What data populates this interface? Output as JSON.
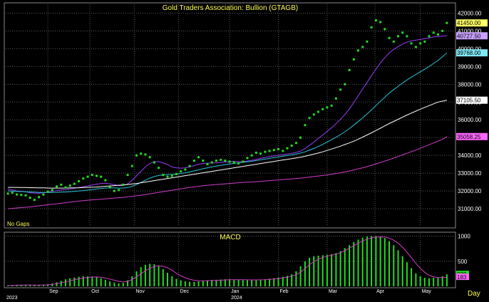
{
  "chart_data": [
    {
      "type": "scatter",
      "title": "Gold Traders Association: Bullion (GTAGB)",
      "note": "No Gaps",
      "colors": {
        "background": "#000000",
        "grid": "#5a5a5a",
        "price": "#22dd22",
        "ma1": "#9b3cff",
        "ma2": "#26c6da",
        "ma3": "#ffffff",
        "ma4": "#d23cc8",
        "title": "#ffff55",
        "axis_text": "#ffffff"
      },
      "ylim": [
        30000,
        42500
      ],
      "yticks": [
        "31000.00",
        "32000.00",
        "33000.00",
        "34000.00",
        "35000.00",
        "36000.00",
        "37000.00",
        "38000.00",
        "39000.00",
        "40000.00",
        "41000.00",
        "42000.00"
      ],
      "x_months": [
        "Sep",
        "Oct",
        "Nov",
        "Dec",
        "Jan",
        "Feb",
        "Mar",
        "Apr",
        "May"
      ],
      "x_years": [
        "2023",
        "2024"
      ],
      "x_unit": "Day",
      "grid": true,
      "series": [
        {
          "values": [
            31850,
            31900,
            31800,
            31780,
            31750,
            31620,
            31500,
            31650,
            31800,
            31950,
            32050,
            32250,
            32350,
            32200,
            32300,
            32400,
            32550,
            32700,
            32800,
            32900,
            32850,
            32800,
            32600,
            32200,
            32000,
            32050,
            32350,
            32900,
            33400,
            34000,
            34100,
            34050,
            33900,
            33600,
            33300,
            32900,
            32800,
            32850,
            32950,
            33100,
            33200,
            33400,
            33700,
            33900,
            33700,
            33500,
            33600,
            33700,
            33750,
            33700,
            33650,
            33600,
            33550,
            33650,
            33850,
            34000,
            34150,
            34100,
            34200,
            34250,
            34300,
            34350,
            34250,
            34400,
            34550,
            34700,
            35000,
            35700,
            36100,
            36300,
            36450,
            36600,
            36700,
            36800,
            37200,
            37700,
            38000,
            38800,
            39400,
            39900,
            40100,
            40400,
            41200,
            41600,
            41500,
            41100,
            40600,
            40400,
            40700,
            40900,
            40700,
            40300,
            40100,
            40300,
            40400,
            40700,
            40900,
            40800,
            41000,
            41450
          ]
        },
        {
          "values": [
            32100,
            32050,
            32000,
            31980,
            31950,
            31900,
            31880,
            31870,
            31900,
            31930,
            31970,
            32010,
            32050,
            32080,
            32110,
            32150,
            32190,
            32230,
            32280,
            32330,
            32380,
            32420,
            32430,
            32400,
            32350,
            32300,
            32300,
            32400,
            32600,
            32850,
            33100,
            33350,
            33550,
            33650,
            33650,
            33580,
            33480,
            33350,
            33300,
            33280,
            33300,
            33350,
            33420,
            33500,
            33550,
            33560,
            33570,
            33580,
            33600,
            33630,
            33650,
            33660,
            33650,
            33650,
            33680,
            33720,
            33780,
            33830,
            33880,
            33930,
            33970,
            34010,
            34040,
            34080,
            34120,
            34170,
            34240,
            34380,
            34560,
            34750,
            34950,
            35150,
            35350,
            35550,
            35780,
            36030,
            36300,
            36620,
            36970,
            37350,
            37730,
            38100,
            38480,
            38850,
            39200,
            39500,
            39760,
            39960,
            40120,
            40260,
            40370,
            40440,
            40480,
            40520,
            40560,
            40610,
            40660,
            40690,
            40710,
            40727
          ]
        },
        {
          "values": [
            32000,
            31990,
            31975,
            31965,
            31955,
            31945,
            31930,
            31915,
            31910,
            31910,
            31915,
            31920,
            31930,
            31945,
            31960,
            31980,
            32000,
            32020,
            32050,
            32080,
            32110,
            32140,
            32160,
            32170,
            32170,
            32160,
            32160,
            32190,
            32260,
            32360,
            32480,
            32600,
            32720,
            32810,
            32870,
            32900,
            32920,
            32930,
            32950,
            32980,
            33020,
            33070,
            33130,
            33190,
            33250,
            33300,
            33350,
            33400,
            33440,
            33480,
            33520,
            33550,
            33580,
            33610,
            33640,
            33670,
            33710,
            33750,
            33790,
            33830,
            33870,
            33910,
            33950,
            33990,
            34030,
            34080,
            34130,
            34200,
            34290,
            34390,
            34500,
            34620,
            34750,
            34880,
            35020,
            35170,
            35330,
            35510,
            35700,
            35900,
            36110,
            36330,
            36560,
            36800,
            37040,
            37270,
            37500,
            37700,
            37890,
            38070,
            38240,
            38400,
            38550,
            38700,
            38850,
            39000,
            39170,
            39340,
            39550,
            39768
          ]
        },
        {
          "values": [
            32200,
            32200,
            32200,
            32195,
            32190,
            32185,
            32180,
            32175,
            32170,
            32165,
            32160,
            32160,
            32160,
            32165,
            32170,
            32175,
            32180,
            32190,
            32200,
            32210,
            32220,
            32240,
            32260,
            32280,
            32300,
            32320,
            32340,
            32360,
            32390,
            32420,
            32460,
            32500,
            32540,
            32580,
            32620,
            32660,
            32700,
            32740,
            32780,
            32820,
            32860,
            32900,
            32940,
            32980,
            33020,
            33060,
            33100,
            33140,
            33180,
            33220,
            33260,
            33300,
            33340,
            33380,
            33420,
            33460,
            33500,
            33540,
            33580,
            33620,
            33660,
            33700,
            33740,
            33780,
            33820,
            33860,
            33900,
            33950,
            34010,
            34070,
            34130,
            34200,
            34280,
            34360,
            34440,
            34520,
            34610,
            34700,
            34800,
            34910,
            35030,
            35150,
            35270,
            35400,
            35530,
            35660,
            35790,
            35910,
            36030,
            36150,
            36270,
            36380,
            36490,
            36600,
            36700,
            36800,
            36900,
            37000,
            37050,
            37105
          ]
        },
        {
          "values": [
            31000,
            31020,
            31040,
            31060,
            31080,
            31100,
            31130,
            31160,
            31190,
            31220,
            31250,
            31280,
            31310,
            31340,
            31370,
            31400,
            31430,
            31450,
            31480,
            31500,
            31520,
            31540,
            31560,
            31580,
            31600,
            31620,
            31640,
            31670,
            31700,
            31730,
            31760,
            31800,
            31840,
            31880,
            31920,
            31960,
            32000,
            32040,
            32080,
            32120,
            32160,
            32200,
            32230,
            32260,
            32290,
            32320,
            32340,
            32360,
            32380,
            32400,
            32420,
            32440,
            32460,
            32480,
            32490,
            32500,
            32520,
            32540,
            32560,
            32580,
            32600,
            32620,
            32640,
            32660,
            32680,
            32700,
            32720,
            32750,
            32780,
            32810,
            32840,
            32870,
            32900,
            32940,
            32980,
            33020,
            33070,
            33120,
            33180,
            33240,
            33300,
            33370,
            33440,
            33520,
            33600,
            33680,
            33760,
            33850,
            33940,
            34030,
            34120,
            34210,
            34300,
            34400,
            34500,
            34600,
            34700,
            34800,
            34900,
            35058
          ]
        }
      ],
      "last_values": [
        "41450.00",
        "40727.50",
        "39768.00",
        "37105.50",
        "35058.25"
      ]
    },
    {
      "type": "bar",
      "title": "MACD",
      "ylim": [
        0,
        1050
      ],
      "yticks": [
        "500",
        "1000"
      ],
      "last_values": [
        "239",
        "183"
      ],
      "series": [
        {
          "values": [
            20,
            25,
            30,
            30,
            30,
            25,
            20,
            25,
            30,
            40,
            55,
            80,
            110,
            140,
            160,
            175,
            190,
            200,
            200,
            195,
            180,
            160,
            130,
            100,
            75,
            60,
            70,
            120,
            200,
            300,
            380,
            430,
            450,
            440,
            400,
            340,
            270,
            200,
            150,
            120,
            100,
            90,
            90,
            100,
            110,
            120,
            125,
            130,
            135,
            140,
            140,
            135,
            130,
            125,
            120,
            120,
            125,
            130,
            140,
            150,
            160,
            175,
            190,
            210,
            240,
            300,
            400,
            500,
            570,
            600,
            610,
            620,
            630,
            640,
            660,
            700,
            760,
            820,
            880,
            930,
            970,
            990,
            1000,
            1000,
            990,
            960,
            900,
            820,
            720,
            600,
            480,
            360,
            260,
            200,
            170,
            160,
            170,
            180,
            200,
            239
          ]
        },
        {
          "values": [
            15,
            18,
            22,
            25,
            27,
            27,
            26,
            25,
            26,
            30,
            38,
            52,
            70,
            90,
            110,
            130,
            150,
            165,
            178,
            185,
            186,
            180,
            165,
            145,
            122,
            100,
            90,
            100,
            135,
            190,
            250,
            310,
            360,
            395,
            410,
            400,
            370,
            320,
            260,
            210,
            170,
            140,
            120,
            112,
            110,
            112,
            115,
            118,
            122,
            126,
            130,
            132,
            132,
            131,
            129,
            128,
            128,
            129,
            132,
            137,
            145,
            155,
            167,
            182,
            200,
            230,
            280,
            350,
            430,
            490,
            540,
            575,
            600,
            620,
            640,
            670,
            710,
            760,
            810,
            860,
            905,
            940,
            965,
            980,
            985,
            980,
            960,
            920,
            860,
            780,
            680,
            570,
            460,
            360,
            280,
            220,
            190,
            175,
            175,
            183
          ]
        }
      ]
    }
  ]
}
